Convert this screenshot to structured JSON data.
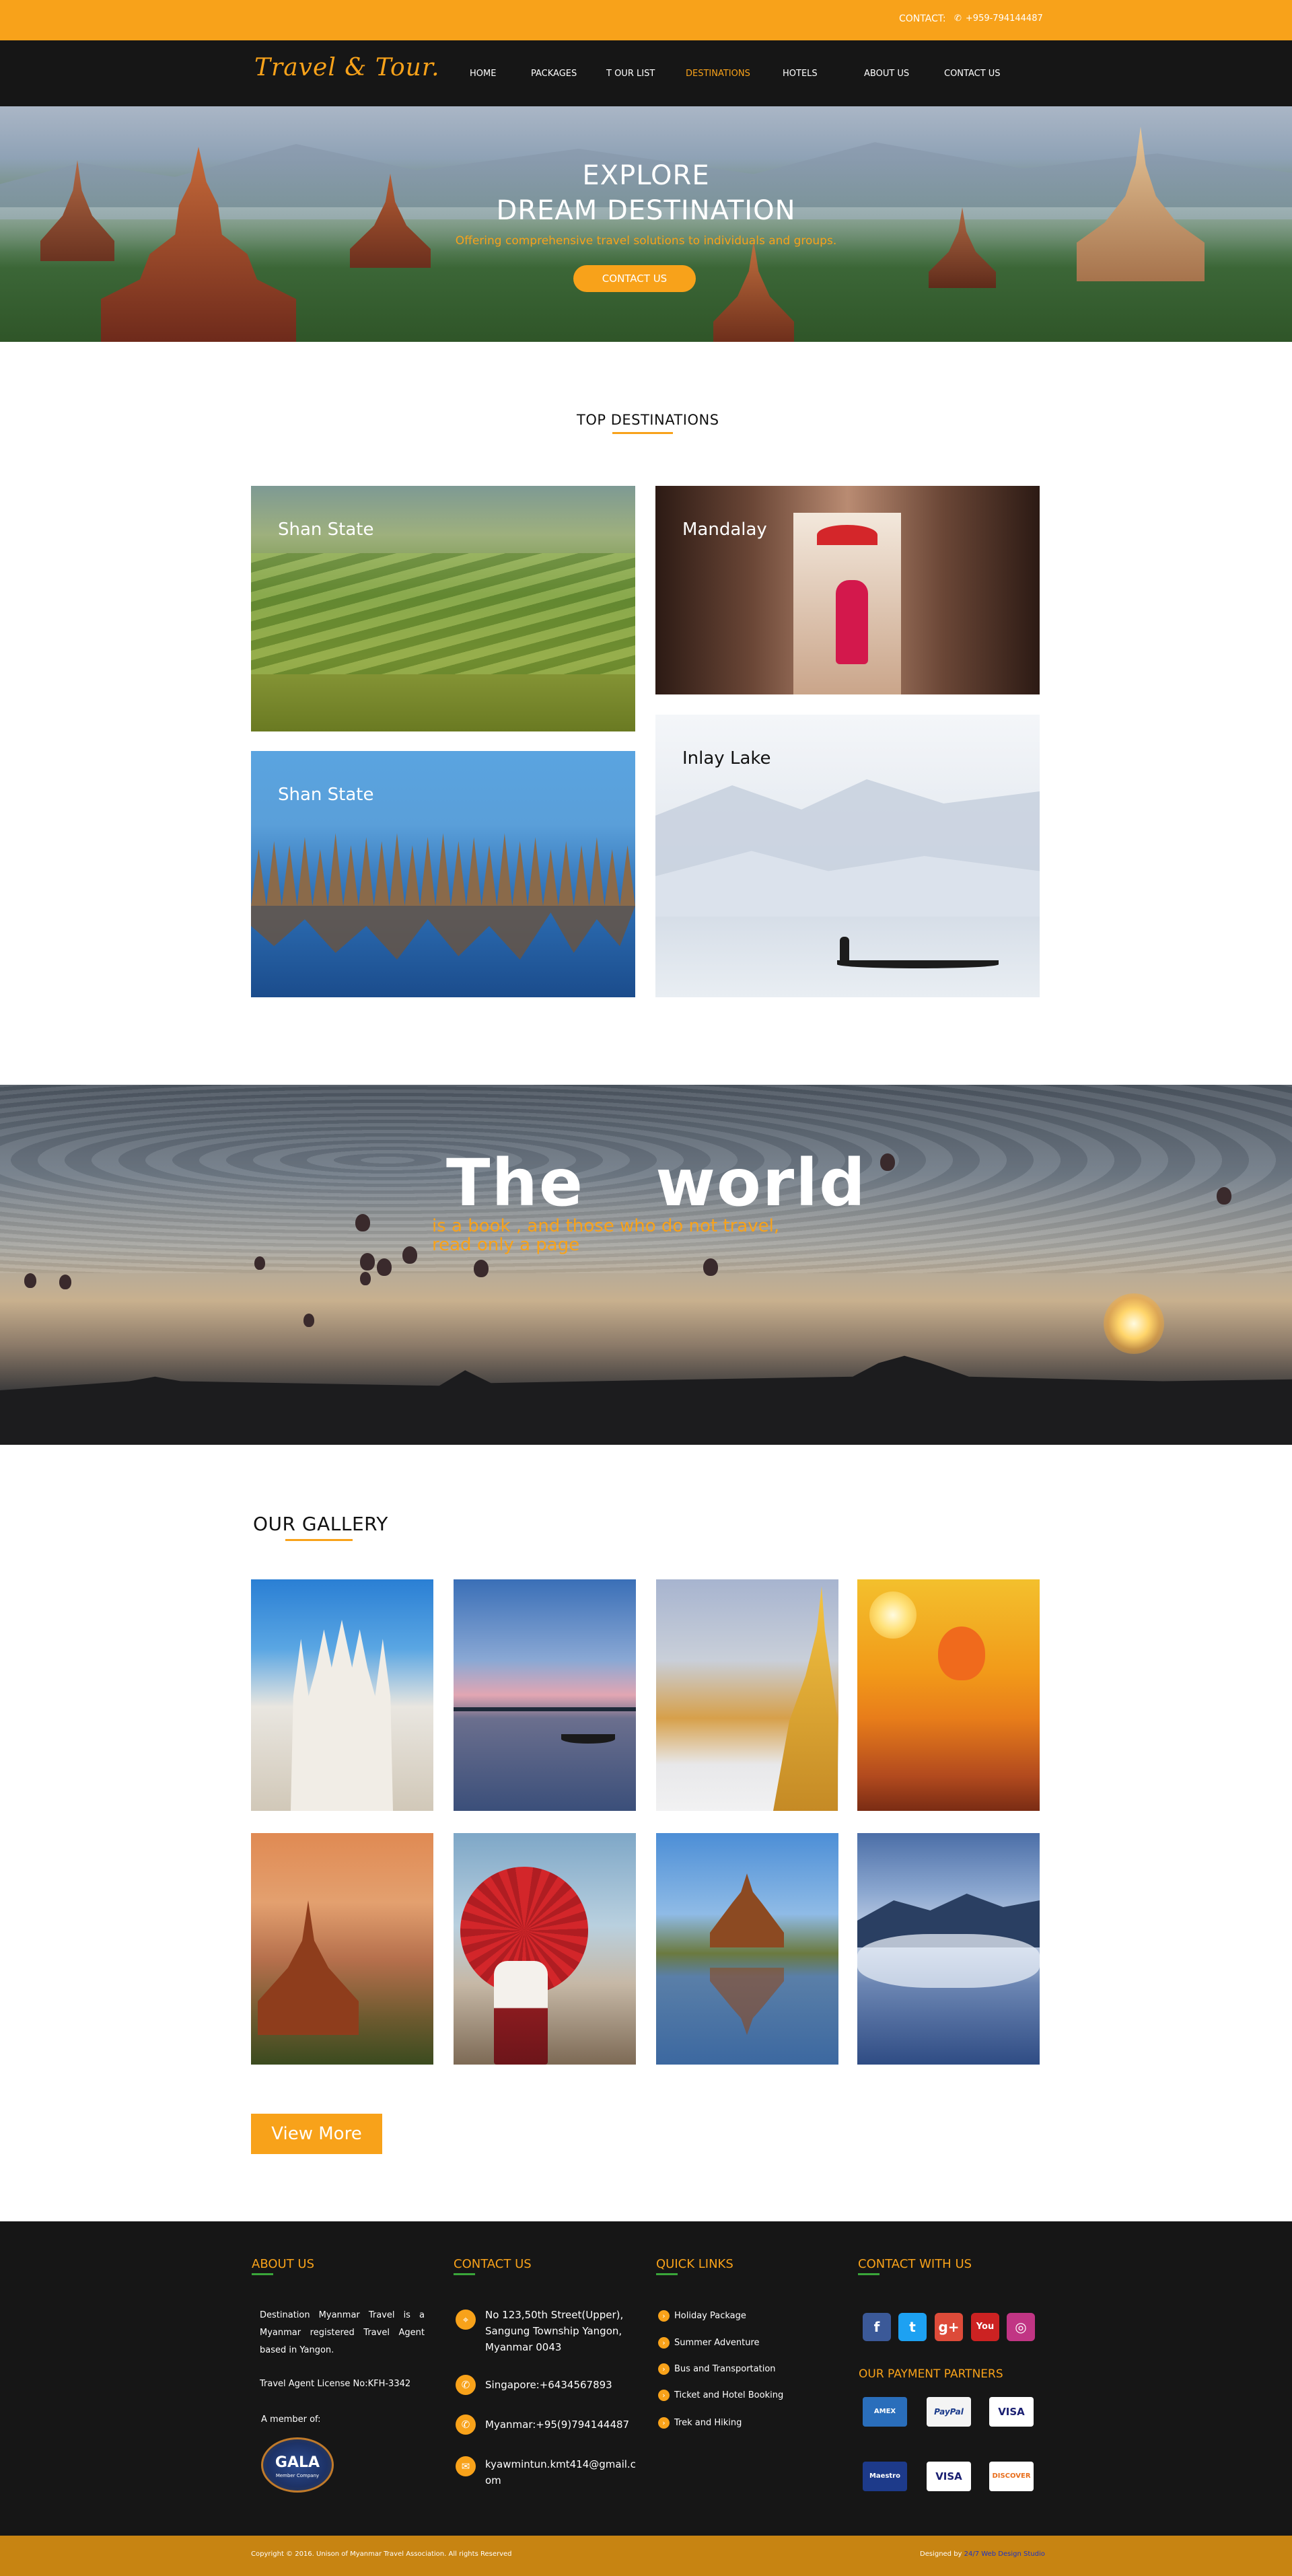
{
  "topbar": {
    "contact_label": "CONTACT:",
    "phone_icon": "phone-icon",
    "phone": "+959-794144487",
    "color": "#f8a21a"
  },
  "nav": {
    "logo": "Travel & Tour.",
    "items": [
      "HOME",
      "PACKAGES",
      "T OUR LIST",
      "DESTINATIONS",
      "HOTELS",
      "ABOUT US",
      "CONTACT US"
    ],
    "active": "DESTINATIONS"
  },
  "hero": {
    "title_line1": "EXPLORE",
    "title_line2": "DREAM DESTINATION",
    "subtitle": "Offering comprehensive travel solutions to individuals and groups.",
    "button": "CONTACT US"
  },
  "destinations": {
    "heading": "TOP DESTINATIONS",
    "cards": [
      "Shan State",
      "Mandalay",
      "Shan State",
      "Inlay Lake"
    ]
  },
  "quote": {
    "big": "The   world",
    "line1": "is a book , and those who do not travel,",
    "line2": "read only a page"
  },
  "gallery": {
    "heading": "OUR GALLERY",
    "button": "View More"
  },
  "footer": {
    "about": {
      "heading": "ABOUT US",
      "text": "Destination Myanmar Travel is a Myanmar registered Travel Agent based in Yangon.",
      "license": "Travel Agent License No:KFH-3342",
      "member": "A member of:",
      "logo_text": "GALA",
      "logo_sub": "Member Company"
    },
    "contact": {
      "heading": "CONTACT US",
      "address": "No 123,50th Street(Upper), Sangung Township Yangon, Myanmar 0043",
      "singapore": "Singapore:+6434567893",
      "myanmar": "Myanmar:+95(9)794144487",
      "email": "kyawmintun.kmt414@gmail.com",
      "icons": [
        "location-icon",
        "phone-icon",
        "phone-icon",
        "mail-icon"
      ]
    },
    "links": {
      "heading": "QUICK LINKS",
      "items": [
        "Holiday Package",
        "Summer Adventure",
        "Bus and Transportation",
        "Ticket and Hotel Booking",
        "Trek and Hiking"
      ]
    },
    "social": {
      "heading": "CONTACT WITH US",
      "icons": [
        "facebook-icon",
        "twitter-icon",
        "google-plus-icon",
        "youtube-icon",
        "instagram-icon"
      ],
      "glyphs": [
        "f",
        "t",
        "g+",
        "You",
        "◎"
      ],
      "colors": [
        "#3b5998",
        "#1da1f2",
        "#dd4b39",
        "#cc2222",
        "#c13584"
      ]
    },
    "payment": {
      "heading": "OUR PAYMENT PARTNERS",
      "cards": [
        "AMEX",
        "PayPal",
        "VISA",
        "Maestro",
        "VISA",
        "DISCOVER"
      ]
    }
  },
  "bottom": {
    "copyright": "Copyright © 2016. Unison of Myanmar Travel Association. All rights Reserved",
    "designed_prefix": "Designed by",
    "designed_by": "24/7 Web Design Studio"
  }
}
